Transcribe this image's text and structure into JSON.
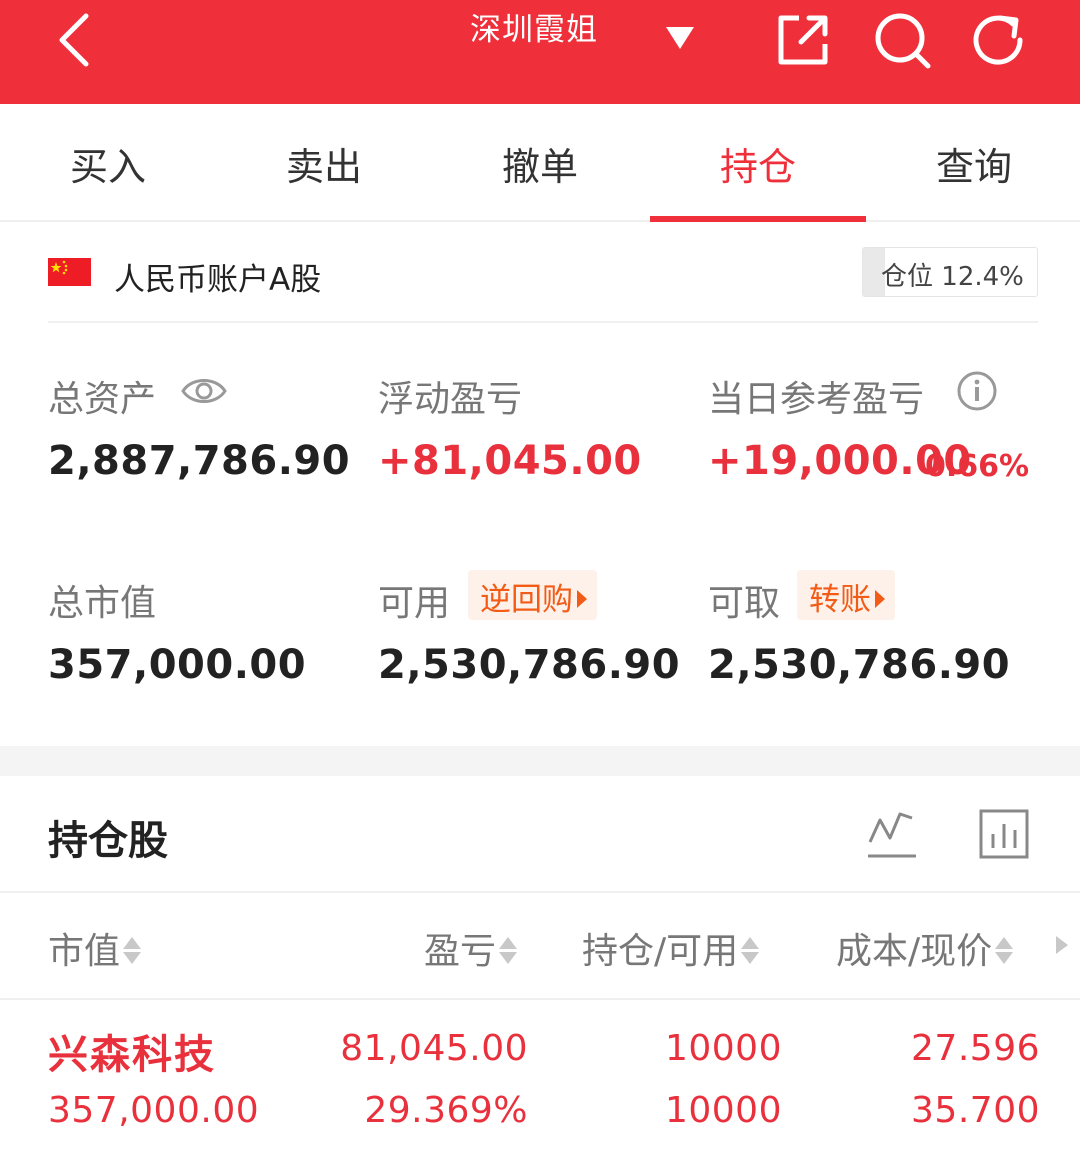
{
  "header": {
    "title": "深圳霞姐",
    "icons": [
      "back-icon",
      "chevron-down-icon",
      "share-icon",
      "search-icon",
      "refresh-icon"
    ],
    "background": "#ef2f3a"
  },
  "tabs": [
    {
      "label": "买入",
      "active": false
    },
    {
      "label": "卖出",
      "active": false
    },
    {
      "label": "撤单",
      "active": false
    },
    {
      "label": "持仓",
      "active": true
    },
    {
      "label": "查询",
      "active": false
    }
  ],
  "account": {
    "name": "人民币账户A股",
    "position_label": "仓位",
    "position_value": "12.4%",
    "position_fraction": 0.124
  },
  "summary": {
    "total_assets_label": "总资产",
    "total_assets": "2,887,786.90",
    "floating_pl_label": "浮动盈亏",
    "floating_pl": "+81,045.00",
    "daily_pl_label": "当日参考盈亏",
    "daily_pl": "+19,000.00",
    "daily_pl_pct": "0.66%",
    "market_value_label": "总市值",
    "market_value": "357,000.00",
    "available_label": "可用",
    "available_chip": "逆回购",
    "available": "2,530,786.90",
    "withdrawable_label": "可取",
    "withdrawable_chip": "转账",
    "withdrawable": "2,530,786.90"
  },
  "holdings": {
    "title": "持仓股",
    "columns": [
      "市值",
      "盈亏",
      "持仓/可用",
      "成本/现价"
    ],
    "rows": [
      {
        "name": "兴森科技",
        "market_value": "357,000.00",
        "pl": "81,045.00",
        "pl_pct": "29.369%",
        "position": "10000",
        "available": "10000",
        "cost": "27.596",
        "price": "35.700"
      }
    ]
  },
  "colors": {
    "accent_red": "#ef2f3a",
    "gain_red": "#e8313c",
    "chip_orange": "#f25c16"
  }
}
